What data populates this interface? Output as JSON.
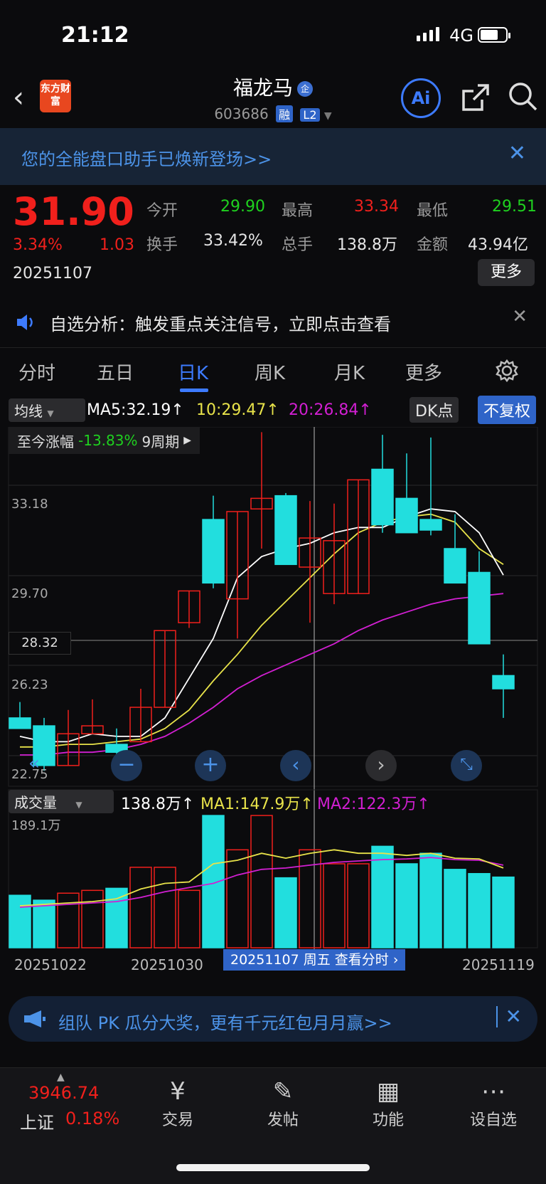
{
  "status_bar": {
    "time": "21:12",
    "network": "4G"
  },
  "header": {
    "logo_text": "东方财富",
    "stock_name": "福龙马",
    "corp_badge": "企",
    "stock_code": "603686",
    "tag_margin": "融",
    "tag_level": "L2",
    "ai_label": "Ai"
  },
  "banner": {
    "text": "您的全能盘口助手已焕新登场>>"
  },
  "quote": {
    "price": "31.90",
    "change_pct": "3.34%",
    "change": "1.03",
    "date": "20251107",
    "fields": [
      {
        "label": "今开",
        "value": "29.90",
        "color": "#1fd11f"
      },
      {
        "label": "最高",
        "value": "33.34",
        "color": "#f0201c"
      },
      {
        "label": "最低",
        "value": "29.51",
        "color": "#1fd11f"
      },
      {
        "label": "换手",
        "value": "33.42%",
        "color": "#e6e6e6"
      },
      {
        "label": "总手",
        "value": "138.8万",
        "color": "#e6e6e6"
      },
      {
        "label": "金额",
        "value": "43.94亿",
        "color": "#e6e6e6"
      }
    ],
    "more_button": "更多"
  },
  "notice": {
    "text": "自选分析：触发重点关注信号，立即点击查看"
  },
  "tabs": [
    "分时",
    "五日",
    "日K",
    "周K",
    "月K",
    "更多"
  ],
  "active_tab": "日K",
  "ma_row": {
    "selector": "均线",
    "ma5": "MA5:32.19↑",
    "ma10": "10:29.47↑",
    "ma20": "20:26.84↑",
    "dk_label": "DK点",
    "adjust_button": "不复权"
  },
  "range_info": {
    "label": "至今涨幅",
    "value": "-13.83%",
    "period": "9周期"
  },
  "kline": {
    "price_labels": [
      "33.18",
      "29.70",
      "26.23",
      "22.75"
    ],
    "crosshair_price": "28.32"
  },
  "volume_row": {
    "selector": "成交量",
    "vol": "138.8万↑",
    "ma1": "MA1:147.9万↑",
    "ma2": "MA2:122.3万↑",
    "max_label": "189.1万"
  },
  "x_labels": {
    "left": "20251022",
    "mid": "20251030",
    "right": "20251119"
  },
  "tooltip": {
    "text": "20251107 周五 查看分时"
  },
  "chart_data": {
    "type": "candlestick",
    "ylim": [
      22.75,
      36.2
    ],
    "candles": [
      {
        "o": 25.2,
        "c": 24.8,
        "h": 25.8,
        "l": 24.8
      },
      {
        "o": 24.9,
        "c": 23.4,
        "h": 25.2,
        "l": 23.2
      },
      {
        "o": 23.4,
        "c": 24.6,
        "h": 25.5,
        "l": 23.4
      },
      {
        "o": 24.6,
        "c": 24.9,
        "h": 25.9,
        "l": 24.6
      },
      {
        "o": 24.2,
        "c": 23.9,
        "h": 24.8,
        "l": 23.5
      },
      {
        "o": 24.3,
        "c": 25.6,
        "h": 26.3,
        "l": 24.3
      },
      {
        "o": 25.6,
        "c": 28.5,
        "h": 28.5,
        "l": 25.6
      },
      {
        "o": 28.8,
        "c": 30.0,
        "h": 30.0,
        "l": 28.6
      },
      {
        "o": 32.7,
        "c": 30.3,
        "h": 33.6,
        "l": 30.1
      },
      {
        "o": 29.7,
        "c": 33.0,
        "h": 33.0,
        "l": 28.2
      },
      {
        "o": 33.1,
        "c": 33.5,
        "h": 36.0,
        "l": 31.6
      },
      {
        "o": 33.6,
        "c": 31.0,
        "h": 33.7,
        "l": 31.0
      },
      {
        "o": 30.9,
        "c": 32.0,
        "h": 33.4,
        "l": 28.8
      },
      {
        "o": 29.9,
        "c": 31.9,
        "h": 33.3,
        "l": 29.5
      },
      {
        "o": 29.9,
        "c": 34.2,
        "h": 34.2,
        "l": 29.9
      },
      {
        "o": 34.6,
        "c": 32.5,
        "h": 35.9,
        "l": 32.2
      },
      {
        "o": 33.5,
        "c": 32.2,
        "h": 35.2,
        "l": 32.2
      },
      {
        "o": 32.7,
        "c": 32.3,
        "h": 35.8,
        "l": 32.1
      },
      {
        "o": 31.6,
        "c": 30.3,
        "h": 32.9,
        "l": 30.3
      },
      {
        "o": 30.7,
        "c": 28.0,
        "h": 31.5,
        "l": 28.0
      },
      {
        "o": 26.8,
        "c": 26.3,
        "h": 27.6,
        "l": 25.2
      }
    ],
    "ma5": [
      24.5,
      24.3,
      24.3,
      24.6,
      24.5,
      24.5,
      25.2,
      26.7,
      28.2,
      30.5,
      31.3,
      31.6,
      31.8,
      32.2,
      32.4,
      32.4,
      32.8,
      33.1,
      33.0,
      32.2,
      30.6
    ],
    "ma10": [
      24.1,
      24.1,
      24.2,
      24.2,
      24.3,
      24.4,
      24.8,
      25.5,
      26.6,
      27.6,
      28.7,
      29.6,
      30.5,
      31.4,
      32.2,
      32.6,
      32.8,
      32.9,
      32.6,
      31.6,
      31.0
    ],
    "ma20": [
      23.8,
      23.8,
      23.9,
      23.9,
      24.0,
      24.2,
      24.5,
      25.0,
      25.6,
      26.3,
      26.8,
      27.2,
      27.6,
      28.0,
      28.5,
      28.9,
      29.2,
      29.5,
      29.7,
      29.8,
      29.9
    ],
    "volume": {
      "ylim": [
        0,
        189.1
      ],
      "values": [
        75,
        68,
        78,
        82,
        85,
        115,
        115,
        82,
        189,
        140,
        189,
        100,
        140,
        120,
        120,
        145,
        120,
        135,
        112,
        106,
        101
      ],
      "ma1": [
        60,
        62,
        64,
        66,
        70,
        84,
        92,
        94,
        120,
        125,
        135,
        128,
        135,
        140,
        135,
        135,
        132,
        135,
        128,
        127,
        114
      ],
      "ma2": [
        58,
        60,
        62,
        64,
        66,
        72,
        80,
        86,
        92,
        104,
        112,
        114,
        118,
        122,
        124,
        126,
        127,
        129,
        126,
        125,
        118
      ]
    }
  },
  "bottom_banner": {
    "text": "组队 PK 瓜分大奖，更有千元红包月月赢>>"
  },
  "bottom_nav": {
    "index_value": "3946.74",
    "index_name": "上证",
    "index_pct": "0.18%",
    "items": [
      "交易",
      "发帖",
      "功能",
      "设自选"
    ]
  },
  "colors": {
    "up": "#f0201c",
    "down": "#1fd11f",
    "candle_down": "#22dede",
    "ma5": "#ffffff",
    "ma10": "#e8e34a",
    "ma20": "#d21fd2",
    "accent": "#3d7bff"
  }
}
